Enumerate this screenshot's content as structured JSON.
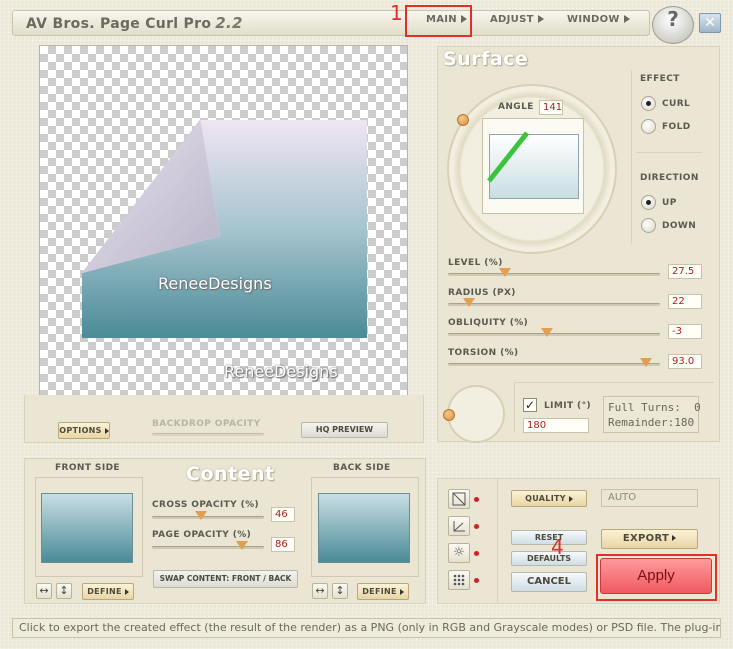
{
  "titlebar": {
    "app_name": "AV Bros. Page Curl Pro",
    "version": "2.2",
    "menu": [
      "MAIN",
      "ADJUST",
      "WINDOW"
    ],
    "help_label": "?",
    "close_label": "✕"
  },
  "annotations": {
    "marker_1": "1",
    "marker_4": "4"
  },
  "preview": {
    "watermark_page": "ReneeDesigns",
    "watermark_canvas": "ReneeDesigns",
    "options_label": "OPTIONS",
    "backdrop_opacity_label": "BACKDROP OPACITY",
    "hq_preview_label": "HQ PREVIEW"
  },
  "surface": {
    "title": "Surface",
    "angle_label": "ANGLE",
    "angle_value": "141",
    "effect_label": "EFFECT",
    "effect_options": [
      "CURL",
      "FOLD"
    ],
    "effect_selected": "CURL",
    "direction_label": "DIRECTION",
    "direction_options": [
      "UP",
      "DOWN"
    ],
    "direction_selected": "UP",
    "sliders": [
      {
        "label": "LEVEL (%)",
        "value": "27.5"
      },
      {
        "label": "RADIUS (PX)",
        "value": "22"
      },
      {
        "label": "OBLIQUITY (%)",
        "value": "-3"
      },
      {
        "label": "TORSION (%)",
        "value": "93.0"
      }
    ],
    "limit_label": "LIMIT (°)",
    "limit_checked": true,
    "limit_value": "180",
    "full_turns": "Full Turns:  0",
    "remainder": "Remainder:180"
  },
  "content": {
    "title": "Content",
    "front_side_label": "FRONT SIDE",
    "back_side_label": "BACK SIDE",
    "cross_opacity_label": "CROSS OPACITY (%)",
    "cross_opacity_value": "46",
    "page_opacity_label": "PAGE OPACITY (%)",
    "page_opacity_value": "86",
    "swap_label": "SWAP CONTENT: FRONT / BACK",
    "define_label": "DEFINE",
    "flip_h_icon": "↔",
    "flip_v_icon": "↕"
  },
  "actions": {
    "quality_label": "QUALITY",
    "quality_value": "AUTO",
    "reset_label": "RESET",
    "defaults_label": "DEFAULTS",
    "cancel_label": "CANCEL",
    "export_label": "EXPORT",
    "apply_label": "Apply"
  },
  "status_text": "Click to export the created effect (the result of the render) as a PNG (only in RGB and Grayscale modes) or PSD file. The plug-in remains opened.",
  "colors": {
    "accent_red": "#e0302a",
    "value_red": "#b02020",
    "thumb_orange": "#e0a050",
    "apply_bg": "#f06c70",
    "angle_line": "#3ac43a",
    "page_gradient_top": "#f0e6f2",
    "page_gradient_bottom": "#4a8b96"
  }
}
